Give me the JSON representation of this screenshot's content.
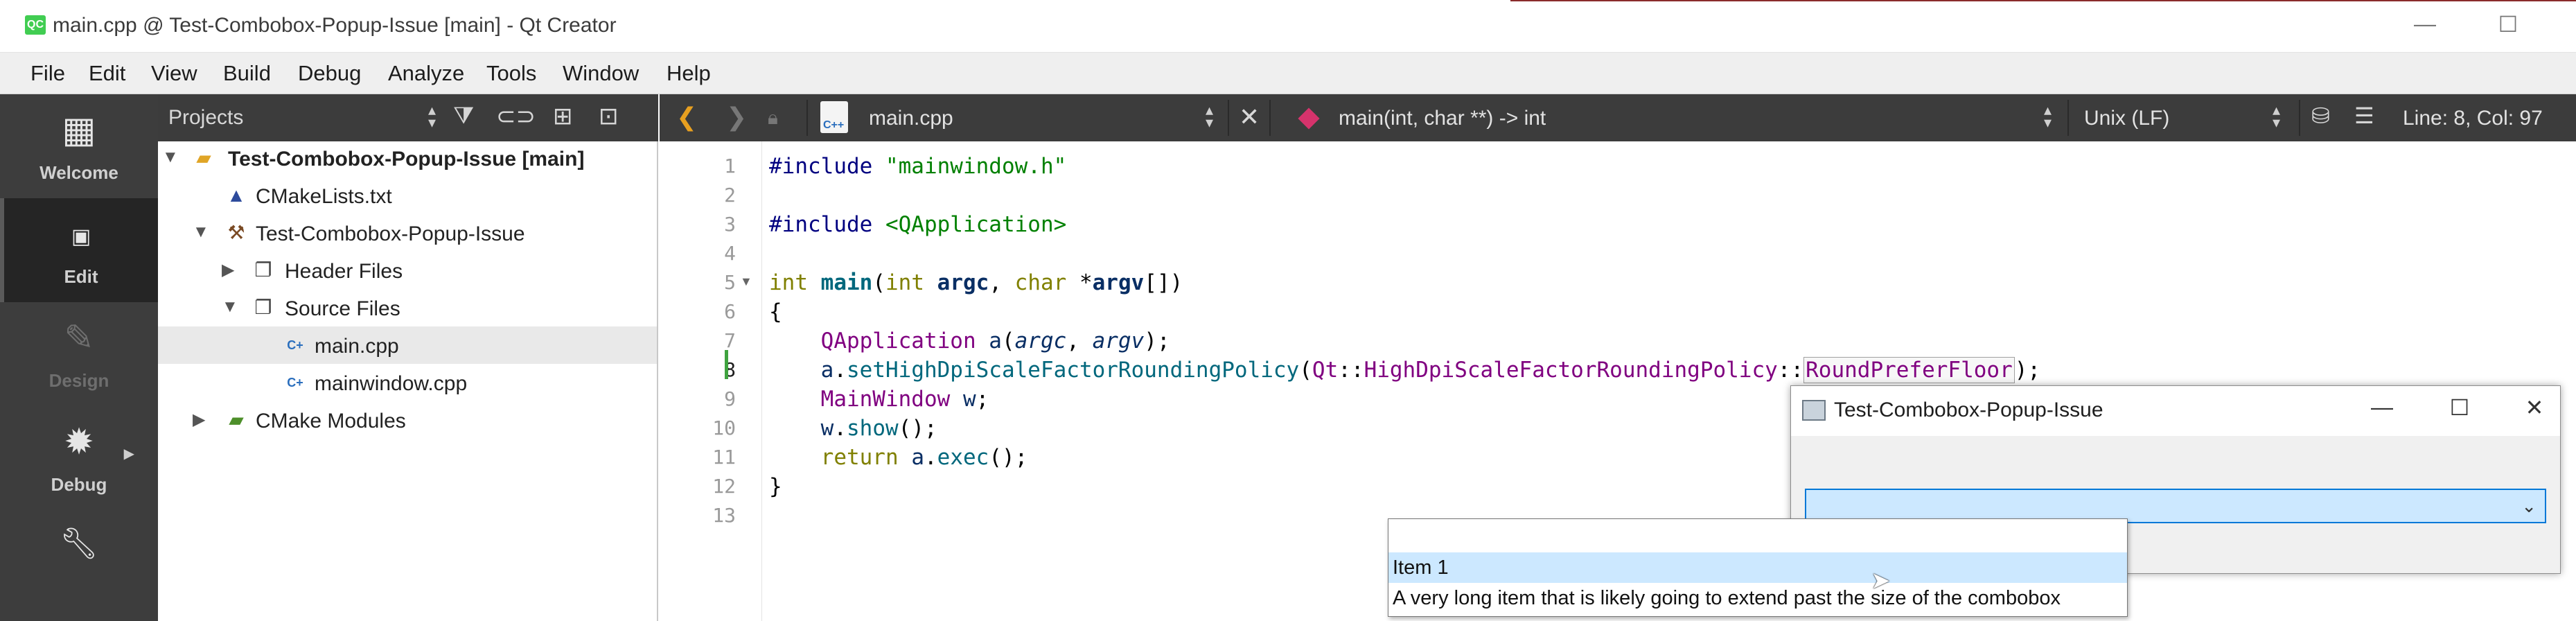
{
  "window": {
    "app_icon": "QC",
    "title": "main.cpp @ Test-Combobox-Popup-Issue [main] - Qt Creator",
    "minimize": "—",
    "maximize": "☐"
  },
  "menubar": [
    "File",
    "Edit",
    "View",
    "Build",
    "Debug",
    "Analyze",
    "Tools",
    "Window",
    "Help"
  ],
  "modes": [
    {
      "label": "Welcome",
      "icon": "grid-icon"
    },
    {
      "label": "Edit",
      "icon": "edit-mode-icon"
    },
    {
      "label": "Design",
      "icon": "pencil-icon"
    },
    {
      "label": "Debug",
      "icon": "bug-icon"
    }
  ],
  "projects_panel": {
    "title": "Projects",
    "tree": [
      {
        "label": "Test-Combobox-Popup-Issue [main]",
        "icon": "project-folder-icon"
      },
      {
        "label": "CMakeLists.txt",
        "icon": "cmake-icon"
      },
      {
        "label": "Test-Combobox-Popup-Issue",
        "icon": "hammer-icon"
      },
      {
        "label": "Header Files",
        "icon": "header-files-icon"
      },
      {
        "label": "Source Files",
        "icon": "source-files-icon"
      },
      {
        "label": "main.cpp",
        "icon": "cpp-file-icon"
      },
      {
        "label": "mainwindow.cpp",
        "icon": "cpp-file-icon"
      },
      {
        "label": "CMake Modules",
        "icon": "cmake-modules-folder-icon"
      }
    ]
  },
  "editor_toolbar": {
    "file_name": "main.cpp",
    "file_badge": "C++",
    "symbol": "main(int, char **) -> int",
    "line_ending": "Unix (LF)",
    "position": "Line: 8, Col: 97"
  },
  "editor": {
    "line_numbers": [
      "1",
      "2",
      "3",
      "4",
      "5",
      "6",
      "7",
      "8",
      "9",
      "10",
      "11",
      "12",
      "13"
    ],
    "current_line": "8"
  },
  "code": {
    "l1_directive": "#include",
    "l1_file": "\"mainwindow.h\"",
    "l3_directive": "#include",
    "l3_file": "<QApplication>",
    "l5_int": "int",
    "l5_main": "main",
    "l5_open": "(",
    "l5_int2": "int",
    "l5_argc": "argc",
    "l5_comma": ", ",
    "l5_char": "char",
    "l5_star": " *",
    "l5_argv": "argv",
    "l5_close": "[])",
    "l6": "{",
    "l7_type": "QApplication",
    "l7_a": "a",
    "l7_open": "(",
    "l7_argc": "argc",
    "l7_comma": ", ",
    "l7_argv": "argv",
    "l7_close": ");",
    "l8_a": "a",
    "l8_dot": ".",
    "l8_fn": "setHighDpiScaleFactorRoundingPolicy",
    "l8_open": "(",
    "l8_ns": "Qt",
    "l8_sep1": "::",
    "l8_enum": "HighDpiScaleFactorRoundingPolicy",
    "l8_sep2": "::",
    "l8_value": "RoundPreferFloor",
    "l8_close": ");",
    "l9_type": "MainWindow",
    "l9_w": "w",
    "l9_semi": ";",
    "l10_w": "w",
    "l10_dot": ".",
    "l10_fn": "show",
    "l10_close": "();",
    "l11_return": "return",
    "l11_a": "a",
    "l11_dot": ".",
    "l11_fn": "exec",
    "l11_close": "();",
    "l12": "}"
  },
  "app_window": {
    "title": "Test-Combobox-Popup-Issue",
    "minimize": "—",
    "maximize": "☐",
    "close": "✕"
  },
  "popup": {
    "items": [
      "",
      "Item 1",
      "A very long item that is likely going to extend past the size of the combobox"
    ]
  }
}
